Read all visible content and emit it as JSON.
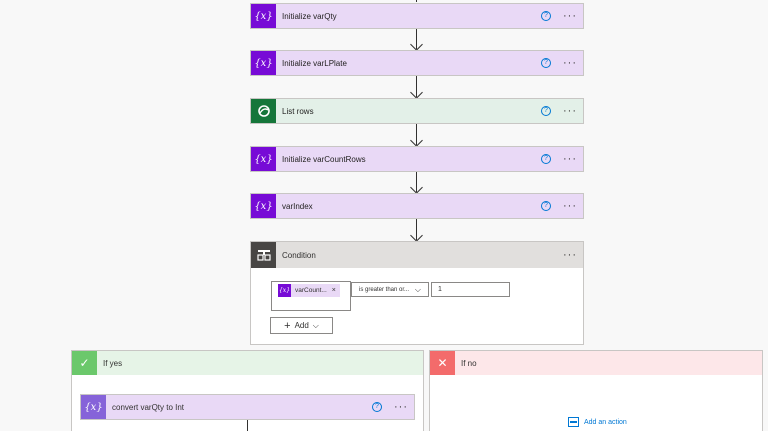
{
  "flow": {
    "steps": [
      {
        "label": "Initialize varQty",
        "icon": "variable-icon",
        "icon_glyph": "{x}"
      },
      {
        "label": "Initialize varLPlate",
        "icon": "variable-icon",
        "icon_glyph": "{x}"
      },
      {
        "label": "List rows",
        "icon": "dataverse-icon",
        "icon_glyph": ""
      },
      {
        "label": "Initialize varCountRows",
        "icon": "variable-icon",
        "icon_glyph": "{x}"
      },
      {
        "label": "varIndex",
        "icon": "variable-icon",
        "icon_glyph": "{x}"
      }
    ],
    "help_glyph": "?",
    "more_glyph": "···"
  },
  "condition": {
    "title": "Condition",
    "token_label": "varCount...",
    "token_glyph": "{x}",
    "remove_glyph": "×",
    "operator": "is greater than or...",
    "value": "1",
    "add_label": "Add"
  },
  "branches": {
    "yes": {
      "title": "If yes",
      "action": "convert varQty to Int",
      "action_glyph": "{x}"
    },
    "no": {
      "title": "If no",
      "add_action_label": "Add an action"
    }
  },
  "colors": {
    "variable": "#770bd6",
    "variable_bg": "#e9d9f6",
    "dataverse": "#15763a",
    "condition": "#484644",
    "yes": "#6bc86b",
    "no": "#f36b6b",
    "link": "#0078d4"
  }
}
